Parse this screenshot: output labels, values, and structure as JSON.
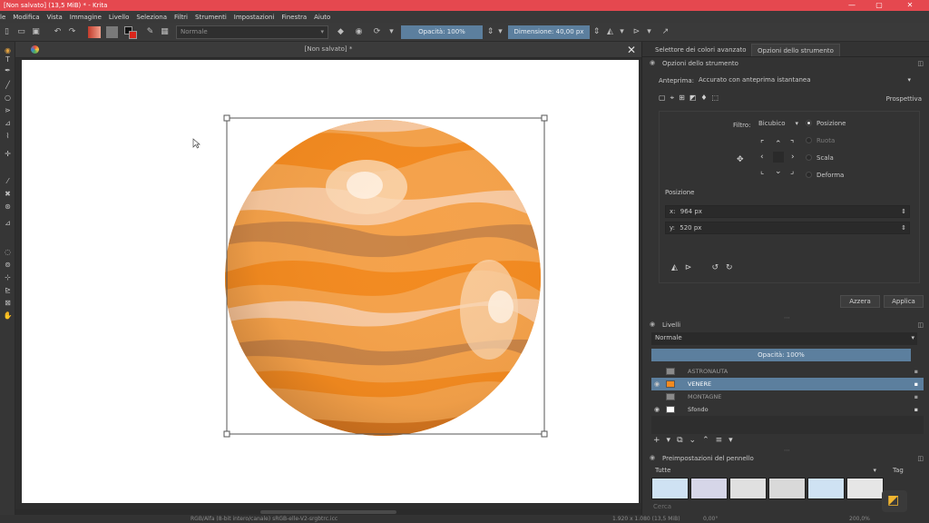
{
  "titlebar": {
    "title": "[Non salvato]  (13,5 MiB)  * - Krita",
    "minimize": "—",
    "maximize": "▢",
    "close": "✕",
    "color": "#e5484f"
  },
  "menu": [
    "le",
    "Modifica",
    "Vista",
    "Immagine",
    "Livello",
    "Seleziona",
    "Filtri",
    "Strumenti",
    "Impostazioni",
    "Finestra",
    "Aiuto"
  ],
  "toolbar": {
    "blend_mode": "Normale",
    "opacity": "Opacità: 100%",
    "size": "Dimensione: 40,00 px"
  },
  "document": {
    "tab_title": "[Non salvato]  *",
    "close_glyph": "✕"
  },
  "dock": {
    "tabs": [
      "Selettore dei colori avanzato",
      "Opzioni dello strumento"
    ],
    "tool_options_title": "Opzioni dello strumento",
    "preview_label": "Anteprima:",
    "preview_value": "Accurato con anteprima istantanea",
    "perspective_label": "Prospettiva",
    "filter_label": "Filtro:",
    "filter_value": "Bicubico",
    "modes": [
      "Posizione",
      "Ruota",
      "Scala",
      "Deforma"
    ],
    "position_title": "Posizione",
    "x_value": "964 px",
    "y_value": "520 px",
    "x_prefix": "x:",
    "y_prefix": "y:",
    "reset_button": "Azzera",
    "apply_button": "Applica"
  },
  "layers": {
    "title": "Livelli",
    "blend_mode": "Normale",
    "opacity": "Opacità:  100%",
    "items": [
      {
        "name": "ASTRONAUTA",
        "selected": false
      },
      {
        "name": "VENERE",
        "selected": true
      },
      {
        "name": "MONTAGNE",
        "selected": false
      },
      {
        "name": "Sfondo",
        "selected": false
      }
    ]
  },
  "brushes": {
    "title": "Preimpostazioni del pennello",
    "filter": "Tutte",
    "tag": "Tag",
    "search_placeholder": "Cerca"
  },
  "status": {
    "color_info": "RGB/Alfa (8-bit intero/canale)  sRGB-elle-V2-srgbtrc.icc",
    "dims": "1.920 x 1.080 (13,5 MiB)",
    "rotation": "0,00°",
    "zoom": "200,0%"
  },
  "colors": {
    "accent": "#5c7f9e",
    "planet_light": "#f8c9a0",
    "planet_orange": "#f38a1f",
    "planet_mid": "#f5a24a",
    "planet_shadow": "#b97945"
  }
}
